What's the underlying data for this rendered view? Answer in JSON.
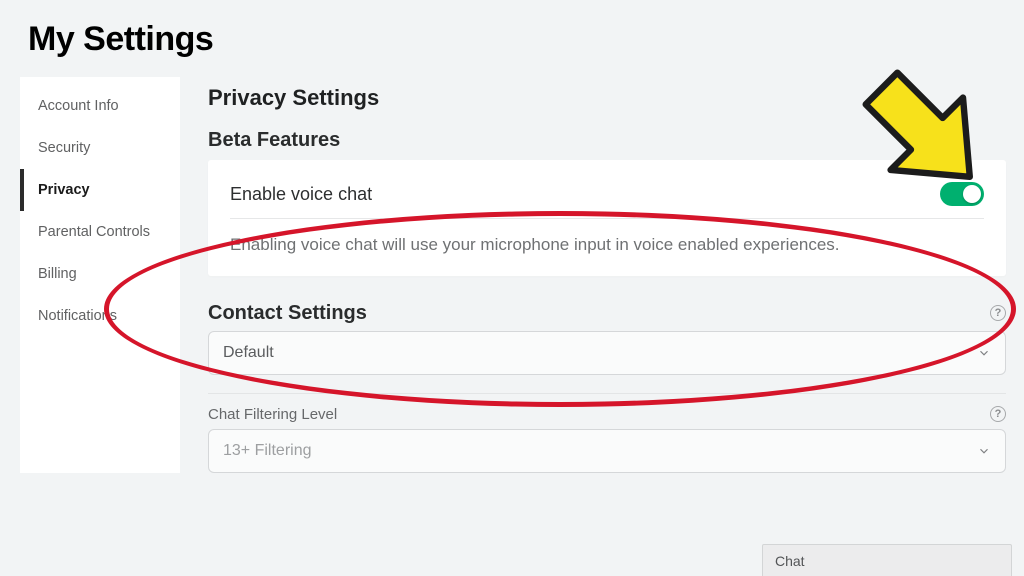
{
  "page": {
    "title": "My Settings"
  },
  "sidebar": {
    "items": [
      {
        "label": "Account Info"
      },
      {
        "label": "Security"
      },
      {
        "label": "Privacy"
      },
      {
        "label": "Parental Controls"
      },
      {
        "label": "Billing"
      },
      {
        "label": "Notifications"
      }
    ],
    "active_index": 2
  },
  "sections": {
    "privacy_heading": "Privacy Settings",
    "beta_heading": "Beta Features",
    "contact_heading": "Contact Settings",
    "chat_filter_label": "Chat Filtering Level"
  },
  "beta": {
    "toggle_label": "Enable voice chat",
    "toggle_on": true,
    "description": "Enabling voice chat will use your microphone input in voice enabled experiences."
  },
  "contact": {
    "default_select_value": "Default",
    "chat_filter_value": "13+ Filtering"
  },
  "chat_bar": {
    "label": "Chat"
  },
  "colors": {
    "annotation_red": "#d5152a",
    "annotation_yellow": "#f7e11b",
    "toggle_green": "#00b06f"
  }
}
